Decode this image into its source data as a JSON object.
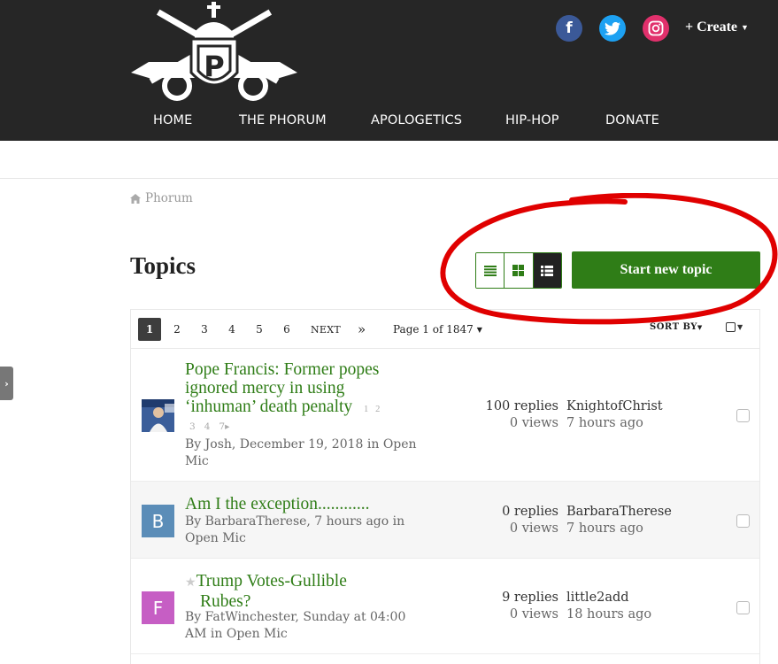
{
  "header": {
    "create_label": "Create",
    "social": [
      {
        "icon": "facebook-icon",
        "glyph": "f",
        "color": "#3b5998"
      },
      {
        "icon": "twitter-icon",
        "glyph": "t",
        "color": "#1da1f2"
      },
      {
        "icon": "instagram-icon",
        "glyph": "◎",
        "color": "#e1306c"
      }
    ],
    "nav": [
      "HOME",
      "THE PHORUM",
      "APOLOGETICS",
      "HIP-HOP",
      "DONATE"
    ]
  },
  "breadcrumb": "Phorum",
  "page_title": "Topics",
  "start_topic_label": "Start new topic",
  "pager": {
    "pages": [
      "1",
      "2",
      "3",
      "4",
      "5",
      "6"
    ],
    "next": "NEXT",
    "last": "»",
    "page_of": "Page 1 of 1847",
    "sort_by": "SORT BY"
  },
  "topics": [
    {
      "title_lines": [
        "Pope Francis: Former popes",
        "ignored mercy in using",
        "‘inhuman’ death penalty"
      ],
      "mini_pages": [
        "1",
        "2",
        "3",
        "4",
        "7"
      ],
      "meta_lines": [
        "By Josh, December 19, 2018 in Open",
        "Mic"
      ],
      "replies": "100 replies",
      "views": "0 views",
      "last_user": "KnightofChrist",
      "last_time": "7 hours ago"
    },
    {
      "avatar_letter": "B",
      "avatar_color": "#5b8db8",
      "title_lines": [
        "Am I the exception............"
      ],
      "meta_lines": [
        "By BarbaraTherese, 7 hours ago in",
        "Open Mic"
      ],
      "replies": "0 replies",
      "views": "0 views",
      "last_user": "BarbaraTherese",
      "last_time": "7 hours ago"
    },
    {
      "avatar_letter": "F",
      "avatar_color": "#c65ec4",
      "title_lines": [
        "Trump Votes-Gullible",
        "Rubes?"
      ],
      "meta_lines": [
        "By FatWinchester, Sunday at 04:00",
        "AM in Open Mic"
      ],
      "replies": "9 replies",
      "views": "0 views",
      "last_user": "little2add",
      "last_time": "18 hours ago"
    }
  ],
  "colors": {
    "accent": "#2f7d17",
    "header_bg": "#262626",
    "annotation": "#e00000"
  }
}
